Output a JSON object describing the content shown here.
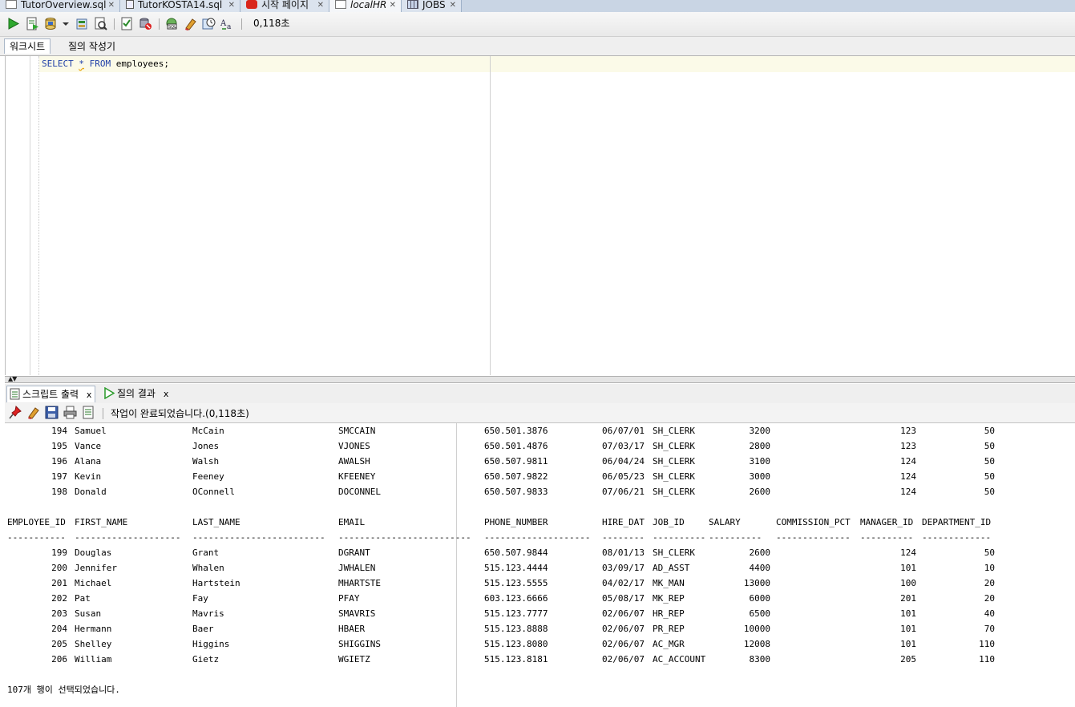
{
  "editor_tabs": [
    {
      "label": "TutorOverview.sql",
      "icon": "sql-file-icon"
    },
    {
      "label": "TutorKOSTA14.sql",
      "icon": "sql-file-icon"
    },
    {
      "label": "시작 페이지",
      "icon": "oracle-icon"
    },
    {
      "label": "localHR",
      "icon": "sql-connection-icon"
    },
    {
      "label": "JOBS",
      "icon": "table-icon"
    }
  ],
  "toolbar": {
    "elapsed": "0,118초",
    "icons": [
      "run-statement-icon",
      "run-script-icon",
      "commit-icon",
      "chevron-down-icon",
      "rollback-icon",
      "explain-plan-icon",
      "autotrace-icon",
      "sql-tuning-icon",
      "unshared-sql-icon",
      "clear-icon",
      "history-icon",
      "format-icon"
    ]
  },
  "subtabs": {
    "worksheet": "워크시트",
    "query_builder": "질의 작성기"
  },
  "editor": {
    "kw_select": "SELECT",
    "star": "*",
    "kw_from": "FROM",
    "rest": " employees;"
  },
  "result_tabs": {
    "script_output": "스크립트 출력",
    "query_result": "질의 결과",
    "close": "x"
  },
  "output_toolbar": {
    "message": "작업이 완료되었습니다.(0,118초)"
  },
  "output": {
    "rows_before": [
      [
        "194",
        "Samuel",
        "McCain",
        "SMCCAIN",
        "650.501.3876",
        "06/07/01",
        "SH_CLERK",
        "3200",
        "",
        "123",
        "50"
      ],
      [
        "195",
        "Vance",
        "Jones",
        "VJONES",
        "650.501.4876",
        "07/03/17",
        "SH_CLERK",
        "2800",
        "",
        "123",
        "50"
      ],
      [
        "196",
        "Alana",
        "Walsh",
        "AWALSH",
        "650.507.9811",
        "06/04/24",
        "SH_CLERK",
        "3100",
        "",
        "124",
        "50"
      ],
      [
        "197",
        "Kevin",
        "Feeney",
        "KFEENEY",
        "650.507.9822",
        "06/05/23",
        "SH_CLERK",
        "3000",
        "",
        "124",
        "50"
      ],
      [
        "198",
        "Donald",
        "OConnell",
        "DOCONNEL",
        "650.507.9833",
        "07/06/21",
        "SH_CLERK",
        "2600",
        "",
        "124",
        "50"
      ]
    ],
    "headers": [
      "EMPLOYEE_ID",
      "FIRST_NAME",
      "LAST_NAME",
      "EMAIL",
      "PHONE_NUMBER",
      "HIRE_DAT",
      "JOB_ID",
      "SALARY",
      "COMMISSION_PCT",
      "MANAGER_ID",
      "DEPARTMENT_ID"
    ],
    "dashes": [
      "-----------",
      "--------------------",
      "-------------------------",
      "-------------------------",
      "--------------------",
      "--------",
      "----------",
      "----------",
      "--------------",
      "----------",
      "-------------"
    ],
    "rows_after": [
      [
        "199",
        "Douglas",
        "Grant",
        "DGRANT",
        "650.507.9844",
        "08/01/13",
        "SH_CLERK",
        "2600",
        "",
        "124",
        "50"
      ],
      [
        "200",
        "Jennifer",
        "Whalen",
        "JWHALEN",
        "515.123.4444",
        "03/09/17",
        "AD_ASST",
        "4400",
        "",
        "101",
        "10"
      ],
      [
        "201",
        "Michael",
        "Hartstein",
        "MHARTSTE",
        "515.123.5555",
        "04/02/17",
        "MK_MAN",
        "13000",
        "",
        "100",
        "20"
      ],
      [
        "202",
        "Pat",
        "Fay",
        "PFAY",
        "603.123.6666",
        "05/08/17",
        "MK_REP",
        "6000",
        "",
        "201",
        "20"
      ],
      [
        "203",
        "Susan",
        "Mavris",
        "SMAVRIS",
        "515.123.7777",
        "02/06/07",
        "HR_REP",
        "6500",
        "",
        "101",
        "40"
      ],
      [
        "204",
        "Hermann",
        "Baer",
        "HBAER",
        "515.123.8888",
        "02/06/07",
        "PR_REP",
        "10000",
        "",
        "101",
        "70"
      ],
      [
        "205",
        "Shelley",
        "Higgins",
        "SHIGGINS",
        "515.123.8080",
        "02/06/07",
        "AC_MGR",
        "12008",
        "",
        "101",
        "110"
      ],
      [
        "206",
        "William",
        "Gietz",
        "WGIETZ",
        "515.123.8181",
        "02/06/07",
        "AC_ACCOUNT",
        "8300",
        "",
        "205",
        "110"
      ]
    ],
    "summary": "107개 행이 선택되었습니다."
  }
}
